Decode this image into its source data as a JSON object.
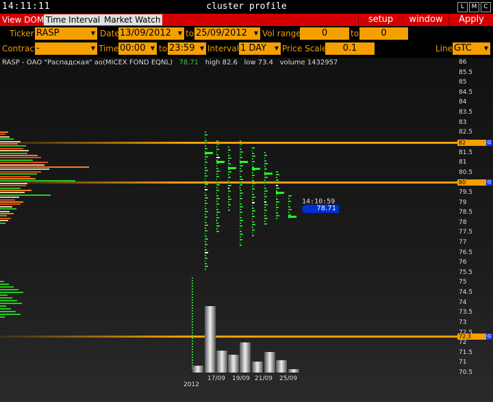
{
  "window": {
    "clock": "14:11:11",
    "title": "cluster profile",
    "buttons": [
      "L",
      "M",
      "C"
    ]
  },
  "tabs": [
    {
      "label": "View DOM"
    },
    {
      "label": "Time Interval"
    },
    {
      "label": "Market Watch"
    }
  ],
  "menu": {
    "setup": "setup",
    "window": "window",
    "apply": "Apply"
  },
  "form": {
    "ticker_label": "Ticker",
    "ticker": "RASP",
    "date_label": "Date",
    "date_from": "13/09/2012",
    "to_label": "to",
    "date_to": "25/09/2012",
    "vol_range_label": "Vol range",
    "vol_from": "0",
    "vol_to_label": "to",
    "vol_to": "0",
    "contract_label": "Contract",
    "contract": "-",
    "time_label": "Time",
    "time_from": "00:00",
    "time_to_label": "to",
    "time_to": "23:59",
    "interval_label": "Interval",
    "interval": "1 DAY",
    "price_scale_label": "Price Scale",
    "price_scale": "0.1",
    "line_label": "Line",
    "line": "GTC"
  },
  "info": {
    "name": "RASP - ОАО \"Распадская\" ао(MICEX FOND EQNL)",
    "last": "78.71",
    "high": "high 82.6",
    "low": "low 73.4",
    "volume": "volume 1432957"
  },
  "axis": {
    "ticks": [
      "86",
      "85.5",
      "85",
      "84.5",
      "84",
      "83.5",
      "83",
      "82.5",
      "82",
      "81.5",
      "81",
      "80.5",
      "80",
      "79.5",
      "79",
      "78.5",
      "78",
      "77.5",
      "77",
      "76.5",
      "76",
      "75.5",
      "75",
      "74.5",
      "74",
      "73.5",
      "73",
      "72.5",
      "72",
      "71.5",
      "71",
      "70.5"
    ]
  },
  "levels": [
    {
      "label": "82",
      "g": "G",
      "color": "#f5a000"
    },
    {
      "label": "80",
      "g": "G",
      "color": "#f5a000"
    },
    {
      "label": "72.3",
      "g": "G",
      "color": "#f5a000"
    }
  ],
  "cursor": {
    "time": "14:10:59",
    "price": "78.71"
  },
  "dates": [
    "2012",
    "17/09",
    "19/09",
    "21/09",
    "25/09"
  ]
}
